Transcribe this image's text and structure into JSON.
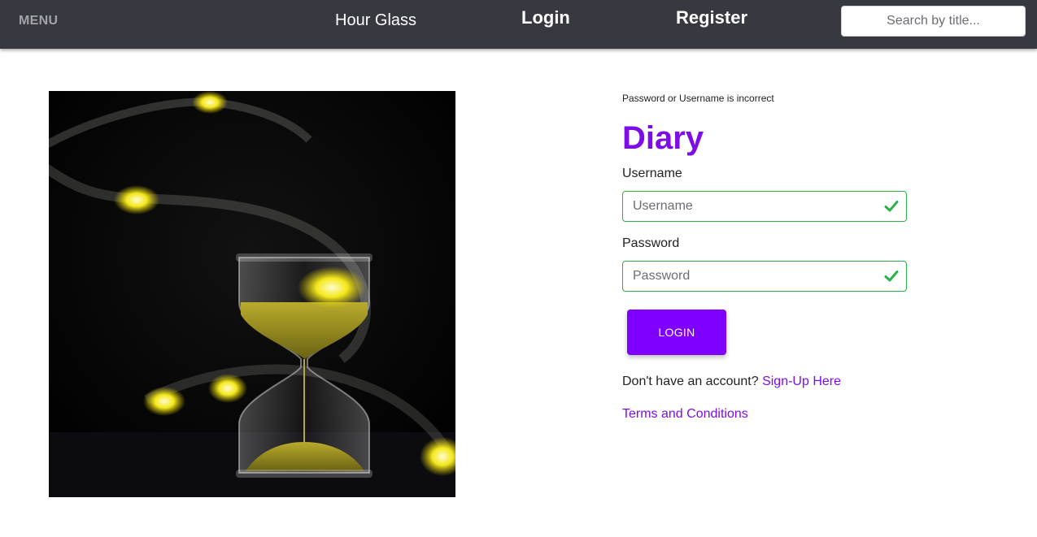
{
  "nav": {
    "menu_label": "MENU",
    "brand": "Hour Glass",
    "login_label": "Login",
    "register_label": "Register",
    "search_placeholder": "Search by title..."
  },
  "hero": {
    "icon": "hourglass-photo"
  },
  "form": {
    "error_message": "Password or Username is incorrect",
    "title": "Diary",
    "username_label": "Username",
    "username_placeholder": "Username",
    "username_value": "",
    "password_label": "Password",
    "password_placeholder": "Password",
    "password_value": "",
    "valid_icon": "check-icon",
    "submit_label": "LOGIN",
    "signup_prompt": "Don't have an account?",
    "signup_link": "Sign-Up Here",
    "terms_link": "Terms and Conditions"
  },
  "colors": {
    "navbar": "#383841",
    "accent": "#7d0de8",
    "button": "#7f00ff",
    "valid": "#2bb04a"
  }
}
